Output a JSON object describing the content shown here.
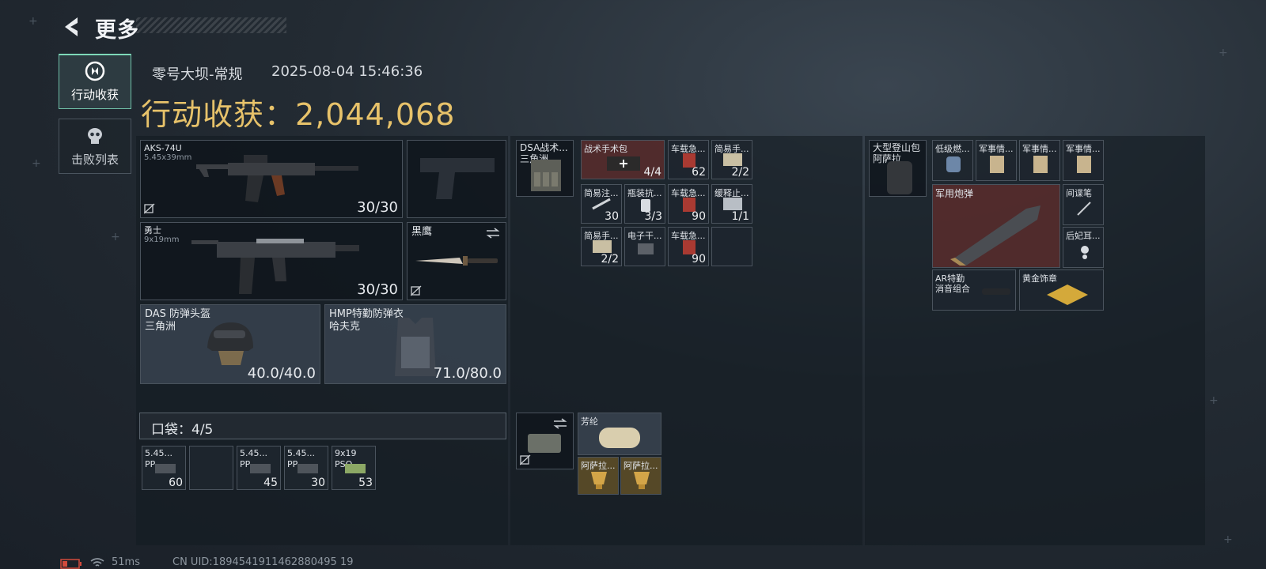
{
  "header": {
    "title": "更多"
  },
  "side_tabs": [
    {
      "label": "行动收获",
      "active": true
    },
    {
      "label": "击败列表",
      "active": false
    }
  ],
  "raid": {
    "map": "零号大坝-常规",
    "datetime": "2025-08-04 15:46:36",
    "loot_label": "行动收获：",
    "loot_value": "2,044,068"
  },
  "weapons": {
    "primary": {
      "name": "AKS-74U",
      "caliber": "5.45x39mm",
      "ammo": "30/30"
    },
    "secondary": {
      "name": "勇士",
      "caliber": "9x19mm",
      "ammo": "30/30"
    },
    "melee": {
      "name": "黑鹰"
    }
  },
  "armor": {
    "helmet": {
      "name": "DAS 防弹头盔",
      "brand": "三角洲",
      "durability": "40.0/40.0"
    },
    "vest": {
      "name": "HMP特勤防弹衣",
      "brand": "哈夫克",
      "durability": "71.0/80.0"
    }
  },
  "pockets": {
    "label": "口袋：",
    "count": "4/5",
    "items": [
      {
        "name": "5.45...",
        "sub": "PP",
        "count": "60"
      },
      {
        "name": "",
        "sub": "",
        "count": ""
      },
      {
        "name": "5.45...",
        "sub": "PP",
        "count": "45"
      },
      {
        "name": "5.45...",
        "sub": "PP",
        "count": "30"
      },
      {
        "name": "9x19",
        "sub": "PSO",
        "count": "53"
      }
    ]
  },
  "chest_rig": {
    "name": "DSA战术...",
    "brand": "三角洲",
    "items": [
      {
        "name": "战术手术包",
        "count": "4/4"
      },
      {
        "name": "车载急...",
        "count": "62"
      },
      {
        "name": "简易手...",
        "count": "2/2"
      },
      {
        "name": "简易注...",
        "count": "30"
      },
      {
        "name": "瓶装抗...",
        "count": "3/3"
      },
      {
        "name": "车载急...",
        "count": "90"
      },
      {
        "name": "缓释止...",
        "count": "1/1"
      },
      {
        "name": "简易手...",
        "count": "2/2"
      },
      {
        "name": "电子干...",
        "count": ""
      },
      {
        "name": "车载急...",
        "count": "90"
      }
    ]
  },
  "case": {
    "items": [
      {
        "name": "芳纶",
        "count": ""
      },
      {
        "name": "阿萨拉...",
        "count": ""
      },
      {
        "name": "阿萨拉...",
        "count": ""
      }
    ]
  },
  "backpack": {
    "name": "大型登山包",
    "brand": "阿萨拉",
    "items": [
      {
        "name": "低级燃..."
      },
      {
        "name": "军事情..."
      },
      {
        "name": "军事情..."
      },
      {
        "name": "军事情..."
      },
      {
        "name": "军用炮弹"
      },
      {
        "name": "间谍笔"
      },
      {
        "name": "后妃耳..."
      },
      {
        "name": "AR特勤",
        "sub": "消音组合"
      },
      {
        "name": "黄金饰章"
      }
    ]
  },
  "status": {
    "ping": "51ms",
    "uid": "CN UID:1894541911462880495 19"
  },
  "colors": {
    "accent_gold": "#e7c26a",
    "active_tab": "#7dd8b8",
    "medical_red": "#562c2c"
  }
}
